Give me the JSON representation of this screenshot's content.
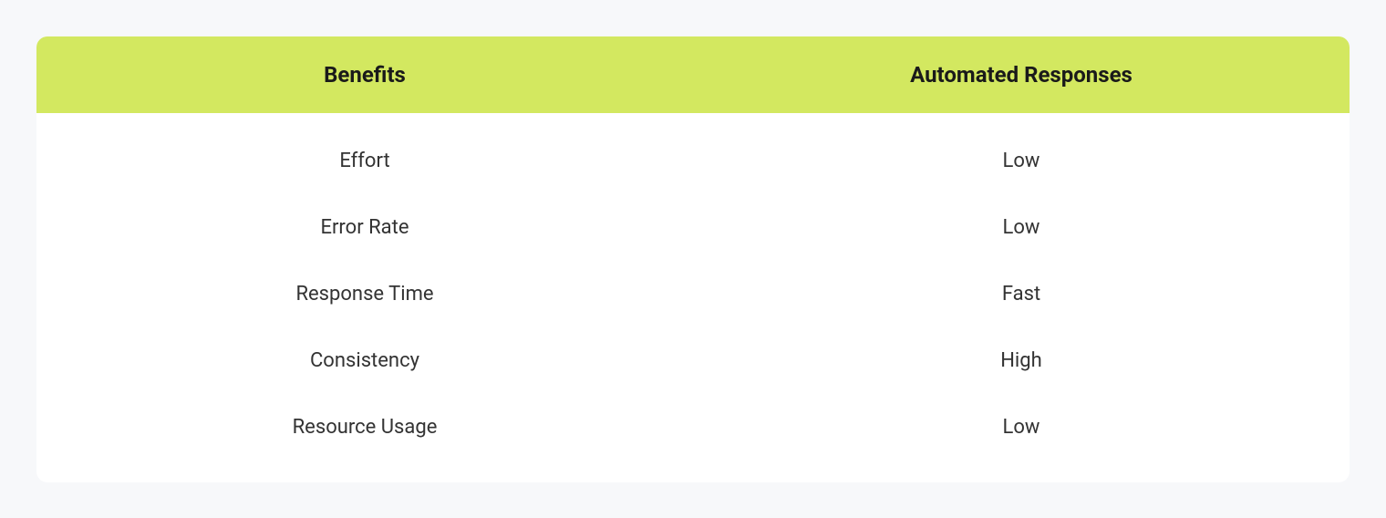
{
  "table": {
    "headers": [
      "Benefits",
      "Automated Responses"
    ],
    "rows": [
      {
        "benefit": "Effort",
        "value": "Low"
      },
      {
        "benefit": "Error Rate",
        "value": "Low"
      },
      {
        "benefit": "Response Time",
        "value": "Fast"
      },
      {
        "benefit": "Consistency",
        "value": "High"
      },
      {
        "benefit": "Resource Usage",
        "value": "Low"
      }
    ]
  },
  "chart_data": {
    "type": "table",
    "title": "",
    "columns": [
      "Benefits",
      "Automated Responses"
    ],
    "data": [
      [
        "Effort",
        "Low"
      ],
      [
        "Error Rate",
        "Low"
      ],
      [
        "Response Time",
        "Fast"
      ],
      [
        "Consistency",
        "High"
      ],
      [
        "Resource Usage",
        "Low"
      ]
    ]
  }
}
